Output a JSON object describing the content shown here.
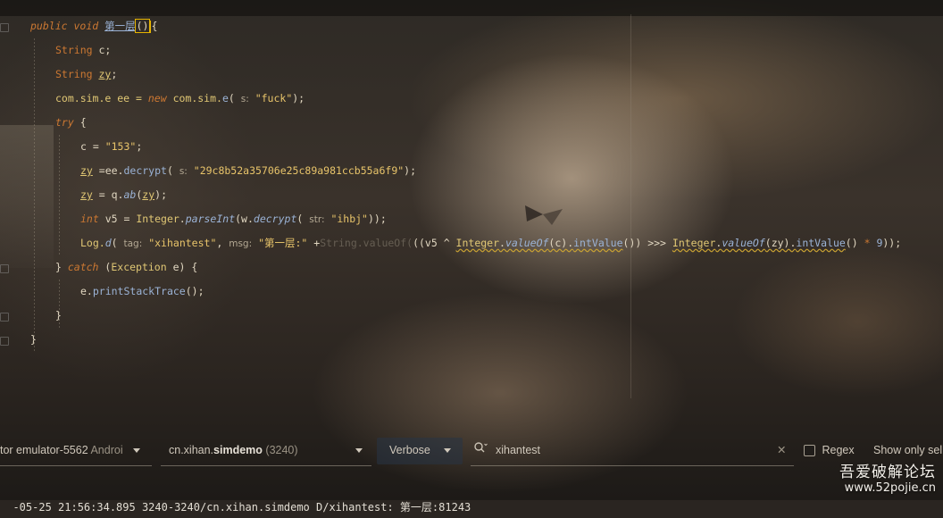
{
  "editor": {
    "line1": {
      "kw1": "public",
      "kw2": "void",
      "name": "第一层",
      "parens": "()",
      "brace": "{"
    },
    "line2": {
      "type": "String",
      "rest": " c;"
    },
    "line3": {
      "type": "String",
      "var": "zy",
      "rest": ";"
    },
    "line4": {
      "t1": "com.sim.e ee = ",
      "kw": "new",
      "t2": " com.sim.",
      "fn": "e",
      "t3": "( ",
      "hint": "s:",
      "str": "\"fuck\"",
      "t4": ");"
    },
    "line5": {
      "kw": "try",
      "rest": " {"
    },
    "line6": {
      "t1": "c = ",
      "str": "\"153\"",
      "t2": ";"
    },
    "line7": {
      "var": "zy",
      "t1": " =ee.",
      "fn": "decrypt",
      "t2": "( ",
      "hint": "s:",
      "str": "\"29c8b52a35706e25c89a981ccb55a6f9\"",
      "t3": ");"
    },
    "line8": {
      "var": "zy",
      "t1": " = q.",
      "fn": "ab",
      "t2": "(",
      "var2": "zy",
      "t3": ");"
    },
    "line9": {
      "kw": "int",
      "t1": " v5 = ",
      "cls": "Integer",
      "t2": ".",
      "fn": "parseInt",
      "t3": "(w.",
      "fn2": "decrypt",
      "t4": "( ",
      "hint": "str:",
      "str": "\"ihbj\"",
      "t5": "));"
    },
    "line10": {
      "t1": "Log.",
      "fn": "d",
      "t2": "( ",
      "hint1": "tag:",
      "str1": "\"xihantest\"",
      "t3": ", ",
      "hint2": "msg:",
      "str2": "\"第一层:\"",
      "t4": " +",
      "dim": "String.valueOf(",
      "t5": "((v5 ^ ",
      "cls1": "Integer",
      "t6": ".",
      "fn1": "valueOf",
      "t7": "(c).",
      "fn2": "intValue",
      "t8": "()) >>> ",
      "cls2": "Integer",
      "t9": ".",
      "fn3": "valueOf",
      "t10": "(zy).",
      "fn4": "intValue",
      "t11": "() ",
      "op": "*",
      "num": " 9",
      "t12": "));"
    },
    "line11": {
      "t1": "} ",
      "kw": "catch",
      "t2": " (",
      "cls": "Exception",
      "t3": " e) {"
    },
    "line12": {
      "t1": "e.",
      "fn": "printStackTrace",
      "t2": "();"
    },
    "line13": {
      "text": "}"
    },
    "line14": {
      "text": "}"
    }
  },
  "logcat": {
    "device": "tor emulator-5562",
    "device_suffix": "Androi",
    "process_pkg": "cn.xihan.",
    "process_bold": "simdemo",
    "process_pid": "(3240)",
    "level": "Verbose",
    "search_value": "xihantest",
    "clear_glyph": "✕",
    "regex_label": "Regex",
    "show_only_label": "Show only sel",
    "log_line": "-05-25 21:56:34.895 3240-3240/cn.xihan.simdemo D/xihantest: 第一层:81243"
  },
  "watermark": {
    "cn": "吾爱破解论坛",
    "url": "www.52pojie.cn"
  },
  "icons": [
    "search-icon",
    "close-icon",
    "chevron-down-icon",
    "fold-icon"
  ]
}
